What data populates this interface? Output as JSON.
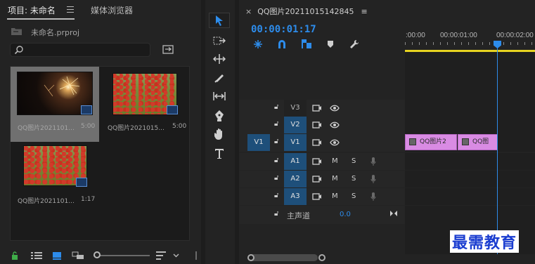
{
  "project": {
    "tab_project": "项目: 未命名",
    "tab_media_browser": "媒体浏览器",
    "project_file": "未命名.prproj",
    "search_placeholder": "",
    "clips": [
      {
        "name": "QQ图片2021101...",
        "duration": "5:00"
      },
      {
        "name": "QQ图片2021015...",
        "duration": "5:00"
      },
      {
        "name": "QQ图片2021101...",
        "duration": "1:17"
      }
    ]
  },
  "tools": [
    "selection-tool",
    "track-select-tool",
    "ripple-edit-tool",
    "razor-tool",
    "slip-tool",
    "pen-tool",
    "hand-tool",
    "type-tool"
  ],
  "timeline": {
    "sequence_name": "QQ图片20211015142845",
    "timecode": "00:00:01:17",
    "ruler": [
      ":00:00",
      "00:00:01:00",
      "00:00:02:00"
    ],
    "tracks_video": [
      {
        "name": "V3",
        "target": false
      },
      {
        "name": "V2",
        "target": true
      },
      {
        "name": "V1",
        "target": true,
        "source": "V1"
      }
    ],
    "tracks_audio": [
      {
        "name": "A1",
        "m": "M",
        "s": "S"
      },
      {
        "name": "A2",
        "m": "M",
        "s": "S"
      },
      {
        "name": "A3",
        "m": "M",
        "s": "S"
      }
    ],
    "master_label": "主声道",
    "master_value": "0.0",
    "clip1": "QQ图片2",
    "clip2": "QQ图"
  },
  "watermark": "最需教育",
  "colors": {
    "accent": "#2d8ceb",
    "playhead": "#2d8ceb",
    "work_area": "#e7d320",
    "clip": "#d98be3"
  }
}
